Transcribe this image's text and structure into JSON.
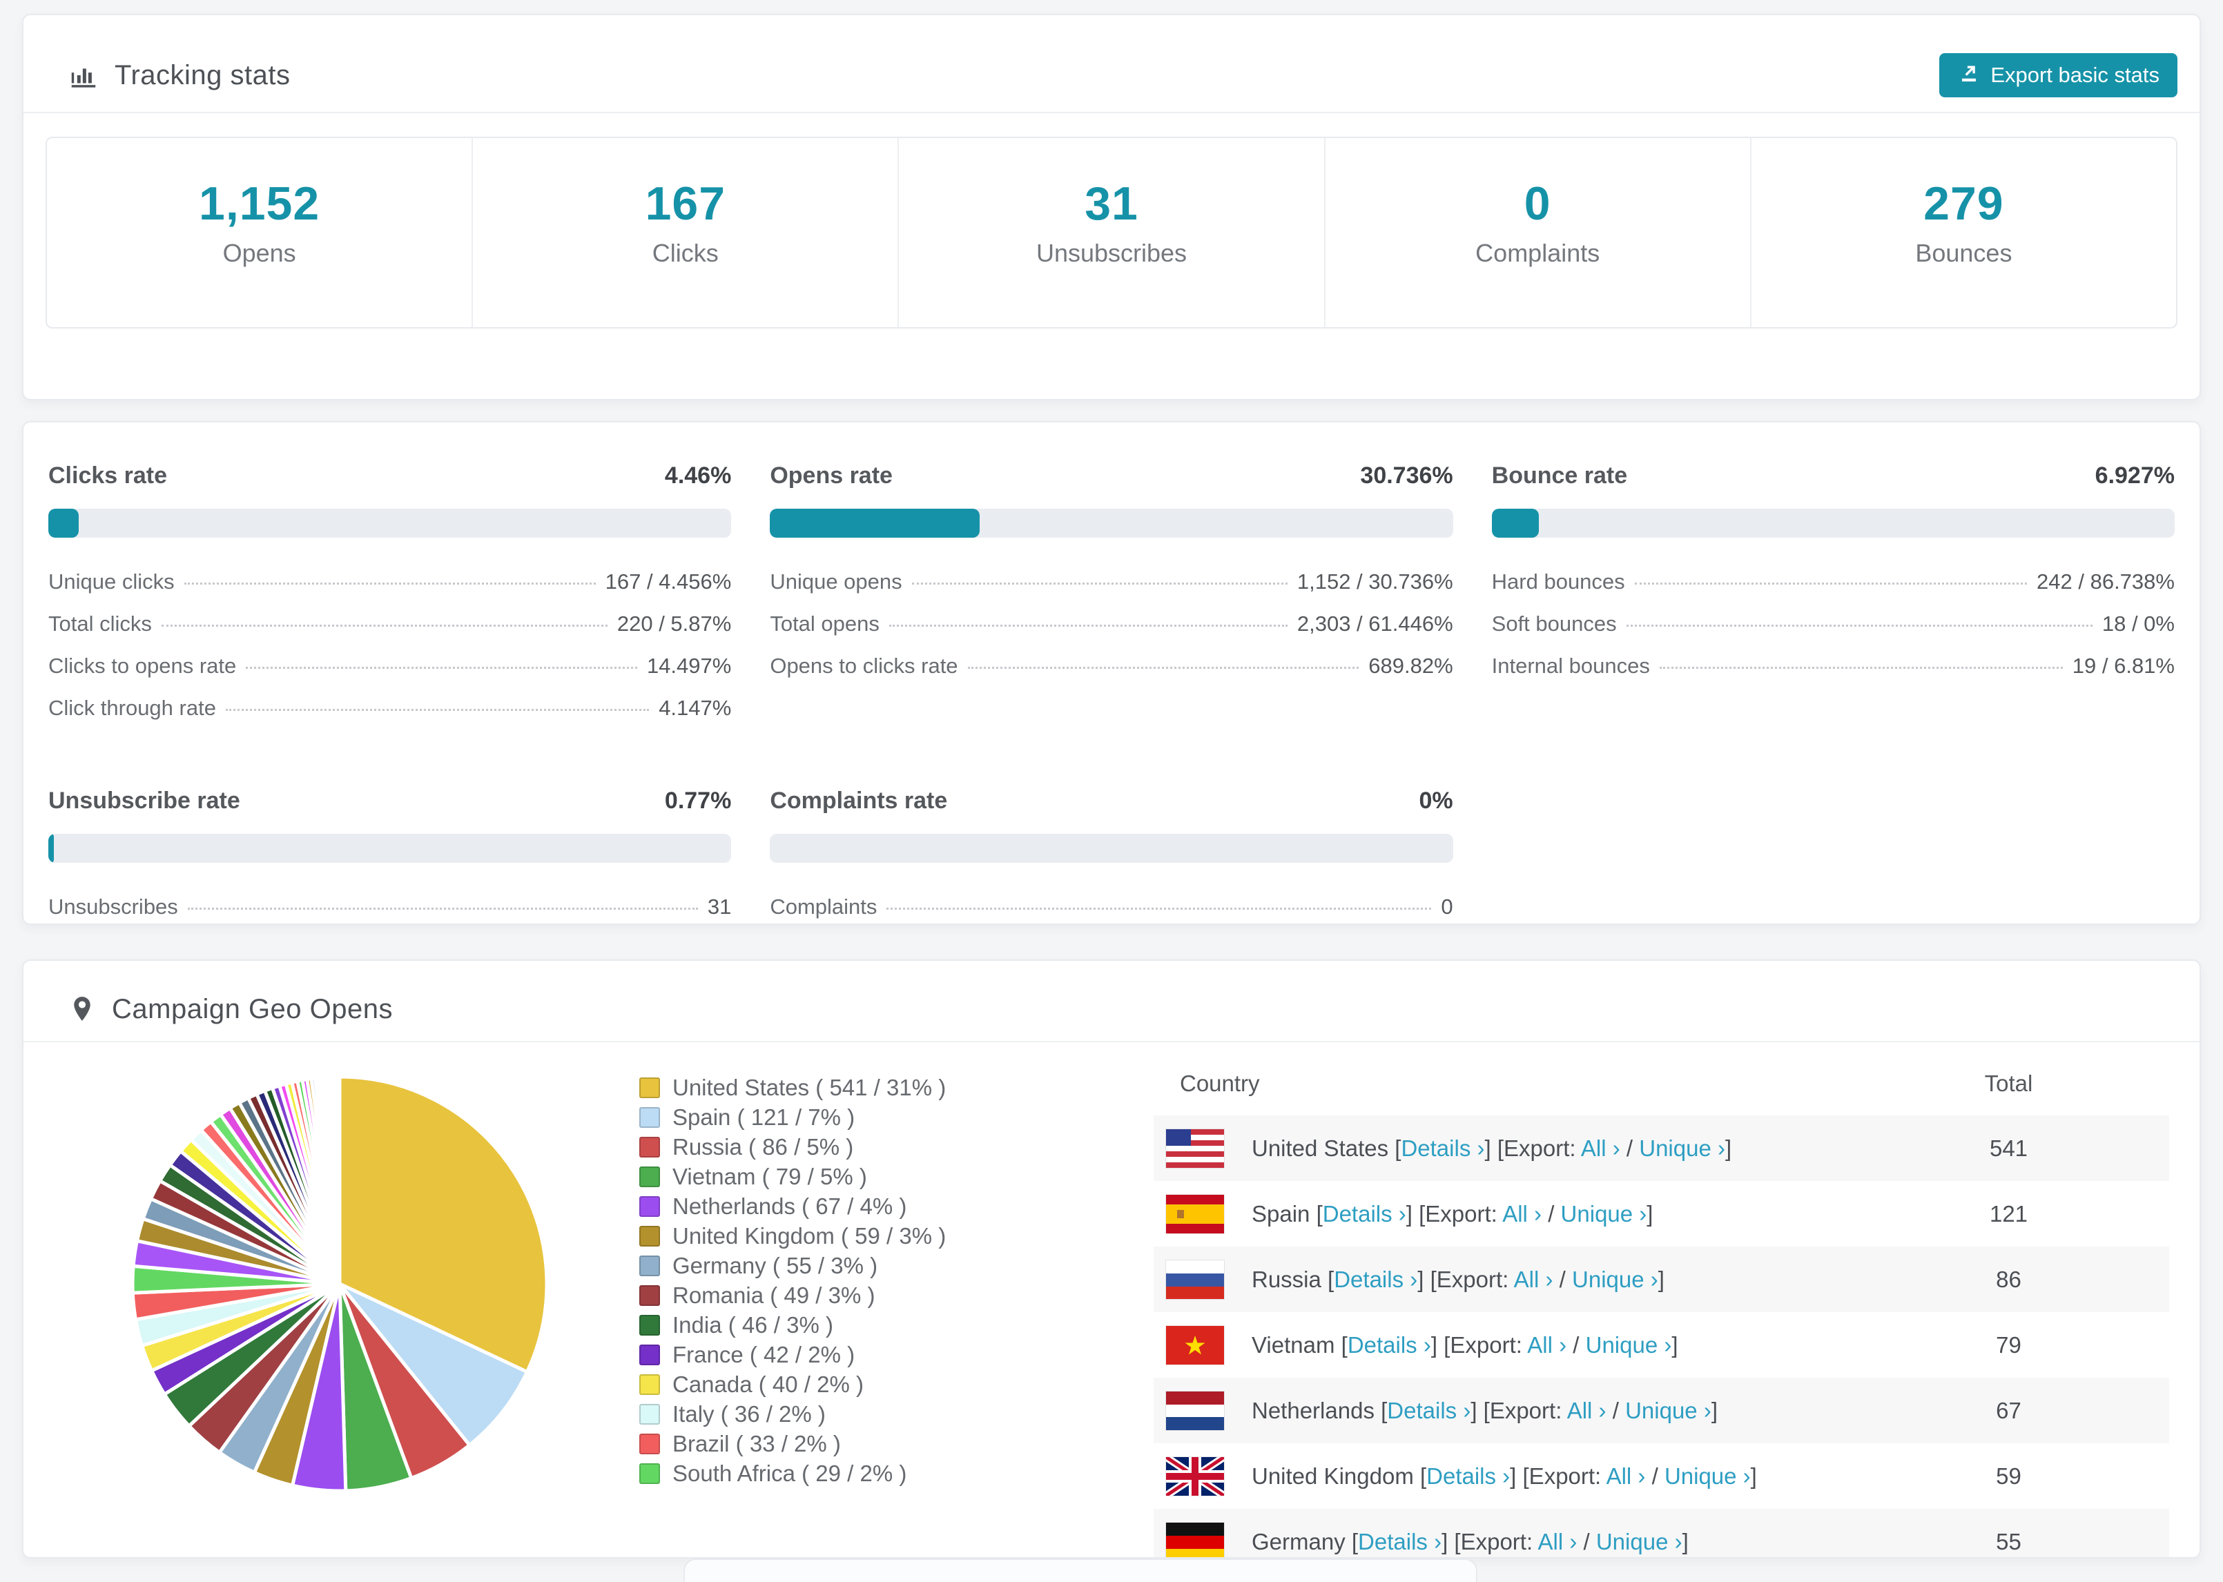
{
  "colors": {
    "accent": "#1692a8",
    "link": "#2e9ec2",
    "page_bg": "#f4f5f7",
    "bar_track": "#e9ecf0",
    "row_stripe": "#f7f7f8"
  },
  "tracking": {
    "title": "Tracking stats",
    "export_button": "Export basic stats",
    "stats": [
      {
        "value": "1,152",
        "label": "Opens"
      },
      {
        "value": "167",
        "label": "Clicks"
      },
      {
        "value": "31",
        "label": "Unsubscribes"
      },
      {
        "value": "0",
        "label": "Complaints"
      },
      {
        "value": "279",
        "label": "Bounces"
      }
    ]
  },
  "rates": {
    "panels": [
      {
        "id": "clicks",
        "title": "Clicks rate",
        "value": "4.46%",
        "bar_pct": 4.46,
        "rows": [
          {
            "label": "Unique clicks",
            "value": "167 / 4.456%"
          },
          {
            "label": "Total clicks",
            "value": "220 / 5.87%"
          },
          {
            "label": "Clicks to opens rate",
            "value": "14.497%"
          },
          {
            "label": "Click through rate",
            "value": "4.147%"
          }
        ]
      },
      {
        "id": "opens",
        "title": "Opens rate",
        "value": "30.736%",
        "bar_pct": 30.736,
        "rows": [
          {
            "label": "Unique opens",
            "value": "1,152 / 30.736%"
          },
          {
            "label": "Total opens",
            "value": "2,303 / 61.446%"
          },
          {
            "label": "Opens to clicks rate",
            "value": "689.82%"
          }
        ]
      },
      {
        "id": "bounce",
        "title": "Bounce rate",
        "value": "6.927%",
        "bar_pct": 6.927,
        "rows": [
          {
            "label": "Hard bounces",
            "value": "242 / 86.738%"
          },
          {
            "label": "Soft bounces",
            "value": "18 / 0%"
          },
          {
            "label": "Internal bounces",
            "value": "19 / 6.81%"
          }
        ]
      },
      {
        "id": "unsubscribe",
        "title": "Unsubscribe rate",
        "value": "0.77%",
        "bar_pct": 0.77,
        "rows": [
          {
            "label": "Unsubscribes",
            "value": "31"
          }
        ]
      },
      {
        "id": "complaints",
        "title": "Complaints rate",
        "value": "0%",
        "bar_pct": 0,
        "rows": [
          {
            "label": "Complaints",
            "value": "0"
          }
        ]
      }
    ]
  },
  "geo": {
    "title": "Campaign Geo Opens",
    "table": {
      "columns": [
        "Country",
        "Total"
      ],
      "details_label": "Details ›",
      "export_prefix": "Export:",
      "all_label": "All ›",
      "unique_label": "Unique ›",
      "rows": [
        {
          "country": "United States",
          "total": "541",
          "flag": "us"
        },
        {
          "country": "Spain",
          "total": "121",
          "flag": "es"
        },
        {
          "country": "Russia",
          "total": "86",
          "flag": "ru"
        },
        {
          "country": "Vietnam",
          "total": "79",
          "flag": "vn"
        },
        {
          "country": "Netherlands",
          "total": "67",
          "flag": "nl"
        },
        {
          "country": "United Kingdom",
          "total": "59",
          "flag": "gb"
        },
        {
          "country": "Germany",
          "total": "55",
          "flag": "de"
        }
      ]
    }
  },
  "chart_data": {
    "type": "pie",
    "title": "Campaign Geo Opens",
    "legend_position": "right-of-pie",
    "start_angle_deg": 0,
    "direction": "clockwise",
    "series": [
      {
        "name": "United States",
        "count": 541,
        "pct": 31,
        "color": "#e8c33d"
      },
      {
        "name": "Spain",
        "count": 121,
        "pct": 7,
        "color": "#bcdcf5"
      },
      {
        "name": "Russia",
        "count": 86,
        "pct": 5,
        "color": "#cf4f4f"
      },
      {
        "name": "Vietnam",
        "count": 79,
        "pct": 5,
        "color": "#4cae4f"
      },
      {
        "name": "Netherlands",
        "count": 67,
        "pct": 4,
        "color": "#9b4df0"
      },
      {
        "name": "United Kingdom",
        "count": 59,
        "pct": 3,
        "color": "#b3912c"
      },
      {
        "name": "Germany",
        "count": 55,
        "pct": 3,
        "color": "#90b0cb"
      },
      {
        "name": "Romania",
        "count": 49,
        "pct": 3,
        "color": "#a04043"
      },
      {
        "name": "India",
        "count": 46,
        "pct": 3,
        "color": "#30793a"
      },
      {
        "name": "France",
        "count": 42,
        "pct": 2,
        "color": "#7430c8"
      },
      {
        "name": "Canada",
        "count": 40,
        "pct": 2,
        "color": "#f6e44b"
      },
      {
        "name": "Italy",
        "count": 36,
        "pct": 2,
        "color": "#d9f8f8"
      },
      {
        "name": "Brazil",
        "count": 33,
        "pct": 2,
        "color": "#f25e5e"
      },
      {
        "name": "South Africa",
        "count": 29,
        "pct": 2,
        "color": "#62d862"
      }
    ],
    "others_tail": {
      "note": "many small unlabeled slices completing the circle",
      "values": [
        1.9,
        1.7,
        1.6,
        1.5,
        1.4,
        1.3,
        1.15,
        1.05,
        0.95,
        0.9,
        0.85,
        0.8,
        0.75,
        0.7,
        0.65,
        0.6,
        0.55,
        0.5,
        0.46,
        0.42,
        0.38,
        0.35,
        0.32,
        0.29,
        0.26,
        0.23,
        0.2,
        0.18,
        0.16,
        0.14,
        0.12,
        0.1,
        0.09,
        0.08,
        0.07,
        0.06,
        0.05,
        0.04,
        0.03,
        0.02
      ],
      "colors": [
        "#a855f7",
        "#ab8b2d",
        "#7d9db8",
        "#96383a",
        "#2f6b33",
        "#46309b",
        "#f7f23e",
        "#e8fbfb",
        "#fa6b6b",
        "#6ee06e",
        "#e04ae0",
        "#8a7a1e",
        "#5c7487",
        "#7a2e2e",
        "#2a2a78",
        "#245c28",
        "#8040d0",
        "#f24af2",
        "#f0ec3c",
        "#fa6b6b",
        "#52d452",
        "#e040fb",
        "#d4a22a",
        "#a8d0f0",
        "#e04545",
        "#44bb44",
        "#9955ee",
        "#c8a832",
        "#99ccf5",
        "#e85555",
        "#55cc55",
        "#aa66ff",
        "#ddb840",
        "#88c4f0",
        "#f06666",
        "#66d466",
        "#bb77ff",
        "#e6c84e",
        "#aad6f2",
        "#f57777"
      ]
    }
  }
}
